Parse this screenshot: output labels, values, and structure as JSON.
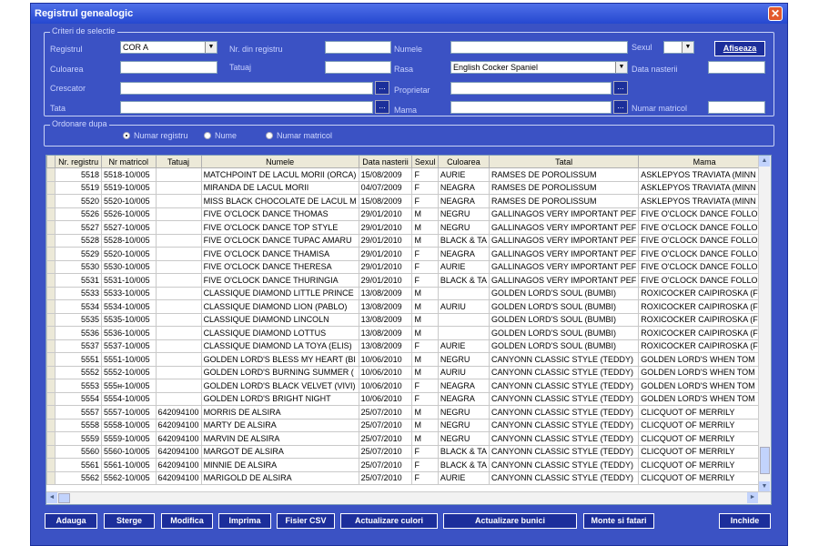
{
  "window": {
    "title": "Registrul genealogic",
    "close": "✕"
  },
  "criteria": {
    "legend": "Criteri de selectie",
    "registrul_label": "Registrul",
    "registrul_value": "COR A",
    "nr_registru_label": "Nr. din registru",
    "nr_registru_value": "",
    "numele_label": "Numele",
    "numele_value": "",
    "sexul_label": "Sexul",
    "sexul_value": "",
    "afiseaza": "Afiseaza",
    "culoarea_label": "Culoarea",
    "culoarea_value": "",
    "tatuaj_label": "Tatuaj",
    "tatuaj_value": "",
    "rasa_label": "Rasa",
    "rasa_value": "English Cocker Spaniel",
    "data_nasterii_label": "Data nasterii",
    "data_nasterii_value": "",
    "crescator_label": "Crescator",
    "crescator_value": "",
    "proprietar_label": "Proprietar",
    "proprietar_value": "",
    "tata_label": "Tata",
    "tata_value": "",
    "mama_label": "Mama",
    "mama_value": "",
    "numar_matricol_label": "Numar matricol",
    "numar_matricol_value": "",
    "dots": "..."
  },
  "order": {
    "legend": "Ordonare dupa",
    "options": [
      "Numar registru",
      "Nume",
      "Numar matricol"
    ],
    "selected": "Numar registru"
  },
  "table": {
    "columns": [
      "Nr. registru",
      "Nr matricol",
      "Tatuaj",
      "Numele",
      "Data nasterii",
      "Sexul",
      "Culoarea",
      "Tatal",
      "Mama"
    ],
    "rows": [
      [
        "5518",
        "5518-10/005",
        "",
        "MATCHPOINT DE LACUL MORII (ORCA)",
        "15/08/2009",
        "F",
        "AURIE",
        "RAMSES DE POROLISSUM",
        "ASKLEPYOS TRAVIATA (MINN"
      ],
      [
        "5519",
        "5519-10/005",
        "",
        "MIRANDA DE LACUL MORII",
        "04/07/2009",
        "F",
        "NEAGRA",
        "RAMSES DE POROLISSUM",
        "ASKLEPYOS TRAVIATA (MINN"
      ],
      [
        "5520",
        "5520-10/005",
        "",
        "MISS BLACK CHOCOLATE DE LACUL M",
        "15/08/2009",
        "F",
        "NEAGRA",
        "RAMSES DE POROLISSUM",
        "ASKLEPYOS TRAVIATA (MINN"
      ],
      [
        "5526",
        "5526-10/005",
        "",
        "FIVE O'CLOCK DANCE THOMAS",
        "29/01/2010",
        "M",
        "NEGRU",
        "GALLINAGOS VERY IMPORTANT PEF",
        "FIVE O'CLOCK DANCE FOLLO"
      ],
      [
        "5527",
        "5527-10/005",
        "",
        "FIVE O'CLOCK DANCE TOP STYLE",
        "29/01/2010",
        "M",
        "NEGRU",
        "GALLINAGOS VERY IMPORTANT PEF",
        "FIVE O'CLOCK DANCE FOLLO"
      ],
      [
        "5528",
        "5528-10/005",
        "",
        "FIVE O'CLOCK DANCE TUPAC AMARU",
        "29/01/2010",
        "M",
        "BLACK & TA",
        "GALLINAGOS VERY IMPORTANT PEF",
        "FIVE O'CLOCK DANCE FOLLO"
      ],
      [
        "5529",
        "5520-10/005",
        "",
        "FIVE O'CLOCK DANCE THAMISA",
        "29/01/2010",
        "F",
        "NEAGRA",
        "GALLINAGOS VERY IMPORTANT PEF",
        "FIVE O'CLOCK DANCE FOLLO"
      ],
      [
        "5530",
        "5530-10/005",
        "",
        "FIVE O'CLOCK DANCE THERESA",
        "29/01/2010",
        "F",
        "AURIE",
        "GALLINAGOS VERY IMPORTANT PEF",
        "FIVE O'CLOCK DANCE FOLLO"
      ],
      [
        "5531",
        "5531-10/005",
        "",
        "FIVE O'CLOCK DANCE THURINGIA",
        "29/01/2010",
        "F",
        "BLACK & TA",
        "GALLINAGOS VERY IMPORTANT PEF",
        "FIVE O'CLOCK DANCE FOLLO"
      ],
      [
        "5533",
        "5533-10/005",
        "",
        "CLASSIQUE DIAMOND LITTLE PRINCE",
        "13/08/2009",
        "M",
        "",
        "GOLDEN LORD'S SOUL (BUMBI)",
        "ROXICOCKER CAIPIROSKA (F"
      ],
      [
        "5534",
        "5534-10/005",
        "",
        "CLASSIQUE DIAMOND LION (PABLO)",
        "13/08/2009",
        "M",
        "AURIU",
        "GOLDEN LORD'S SOUL (BUMBI)",
        "ROXICOCKER CAIPIROSKA (F"
      ],
      [
        "5535",
        "5535-10/005",
        "",
        "CLASSIQUE DIAMOND LINCOLN",
        "13/08/2009",
        "M",
        "",
        "GOLDEN LORD'S SOUL (BUMBI)",
        "ROXICOCKER CAIPIROSKA (F"
      ],
      [
        "5536",
        "5536-10/005",
        "",
        "CLASSIQUE DIAMOND LOTTUS",
        "13/08/2009",
        "M",
        "",
        "GOLDEN LORD'S SOUL (BUMBI)",
        "ROXICOCKER CAIPIROSKA (F"
      ],
      [
        "5537",
        "5537-10/005",
        "",
        "CLASSIQUE DIAMOND LA TOYA (ELIS)",
        "13/08/2009",
        "F",
        "AURIE",
        "GOLDEN LORD'S SOUL (BUMBI)",
        "ROXICOCKER CAIPIROSKA (F"
      ],
      [
        "5551",
        "5551-10/005",
        "",
        "GOLDEN LORD'S BLESS MY HEART (BI",
        "10/06/2010",
        "M",
        "NEGRU",
        "CANYONN CLASSIC STYLE (TEDDY)",
        "GOLDEN LORD'S WHEN TOM"
      ],
      [
        "5552",
        "5552-10/005",
        "",
        "GOLDEN LORD'S BURNING SUMMER (",
        "10/06/2010",
        "M",
        "AURIU",
        "CANYONN CLASSIC STYLE (TEDDY)",
        "GOLDEN LORD'S WHEN TOM"
      ],
      [
        "5553",
        "555н-10/005",
        "",
        "GOLDEN LORD'S BLACK VELVET (VIVI)",
        "10/06/2010",
        "F",
        "NEAGRA",
        "CANYONN CLASSIC STYLE (TEDDY)",
        "GOLDEN LORD'S WHEN TOM"
      ],
      [
        "5554",
        "5554-10/005",
        "",
        "GOLDEN LORD'S BRIGHT NIGHT",
        "10/06/2010",
        "F",
        "NEAGRA",
        "CANYONN CLASSIC STYLE (TEDDY)",
        "GOLDEN LORD'S WHEN TOM"
      ],
      [
        "5557",
        "5557-10/005",
        "642094100",
        "MORRIS DE ALSIRA",
        "25/07/2010",
        "M",
        "NEGRU",
        "CANYONN CLASSIC STYLE (TEDDY)",
        "CLICQUOT OF MERRILY"
      ],
      [
        "5558",
        "5558-10/005",
        "642094100",
        "MARTY DE ALSIRA",
        "25/07/2010",
        "M",
        "NEGRU",
        "CANYONN CLASSIC STYLE (TEDDY)",
        "CLICQUOT OF MERRILY"
      ],
      [
        "5559",
        "5559-10/005",
        "642094100",
        "MARVIN DE ALSIRA",
        "25/07/2010",
        "M",
        "NEGRU",
        "CANYONN CLASSIC STYLE (TEDDY)",
        "CLICQUOT OF MERRILY"
      ],
      [
        "5560",
        "5560-10/005",
        "642094100",
        "MARGOT DE ALSIRA",
        "25/07/2010",
        "F",
        "BLACK & TA",
        "CANYONN CLASSIC STYLE (TEDDY)",
        "CLICQUOT OF MERRILY"
      ],
      [
        "5561",
        "5561-10/005",
        "642094100",
        "MINNIE DE ALSIRA",
        "25/07/2010",
        "F",
        "BLACK & TA",
        "CANYONN CLASSIC STYLE (TEDDY)",
        "CLICQUOT OF MERRILY"
      ],
      [
        "5562",
        "5562-10/005",
        "642094100",
        "MARIGOLD DE ALSIRA",
        "25/07/2010",
        "F",
        "AURIE",
        "CANYONN CLASSIC STYLE (TEDDY)",
        "CLICQUOT OF MERRILY"
      ]
    ]
  },
  "buttons": {
    "adauga": "Adauga",
    "sterge": "Sterge",
    "modifica": "Modifica",
    "imprima": "Imprima",
    "fisier_csv": "Fisier CSV",
    "actualizare_culori": "Actualizare culori",
    "actualizare_bunici": "Actualizare bunici",
    "monte_si_fatari": "Monte si fatari",
    "inchide": "Inchide"
  },
  "colors": {
    "window_bg": "#3b52c4",
    "button_bg": "#1c2e9b",
    "title_bg": "#2548d0"
  }
}
